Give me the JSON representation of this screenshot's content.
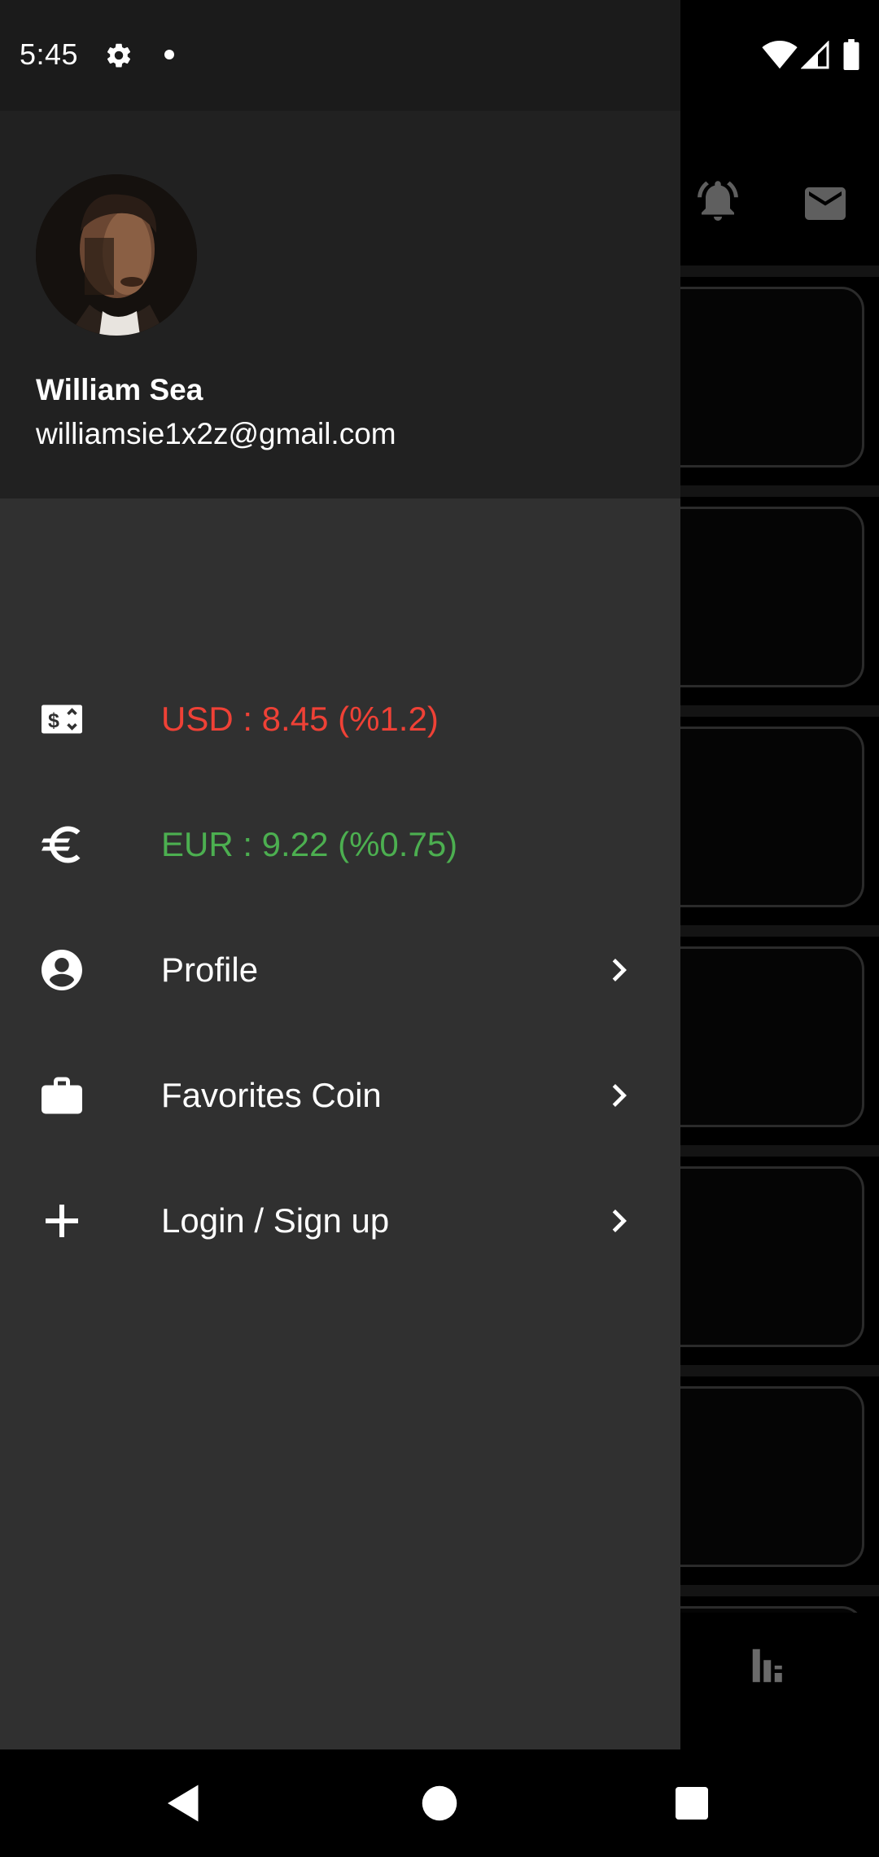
{
  "status_bar": {
    "time": "5:45",
    "icons": [
      "settings-icon",
      "notification-dot",
      "wifi-icon",
      "signal-icon",
      "battery-icon"
    ]
  },
  "background_app": {
    "icons": [
      "bell-icon",
      "mail-icon",
      "stats-icon"
    ]
  },
  "drawer": {
    "user": {
      "name": "William Sea",
      "email": "williamsie1x2z@gmail.com"
    },
    "items": [
      {
        "icon": "dollar-card-icon",
        "label": "USD : 8.45 (%1.2)",
        "color": "#ef4136",
        "has_chevron": false
      },
      {
        "icon": "euro-icon",
        "label": "EUR : 9.22 (%0.75)",
        "color": "#4caf50",
        "has_chevron": false
      },
      {
        "icon": "account-circle-icon",
        "label": "Profile",
        "color": "#ffffff",
        "has_chevron": true
      },
      {
        "icon": "briefcase-icon",
        "label": "Favorites Coin",
        "color": "#ffffff",
        "has_chevron": true
      },
      {
        "icon": "plus-icon",
        "label": "Login / Sign up",
        "color": "#ffffff",
        "has_chevron": true
      }
    ]
  },
  "nav_bar": {
    "buttons": [
      "back-icon",
      "home-icon",
      "recents-icon"
    ]
  }
}
